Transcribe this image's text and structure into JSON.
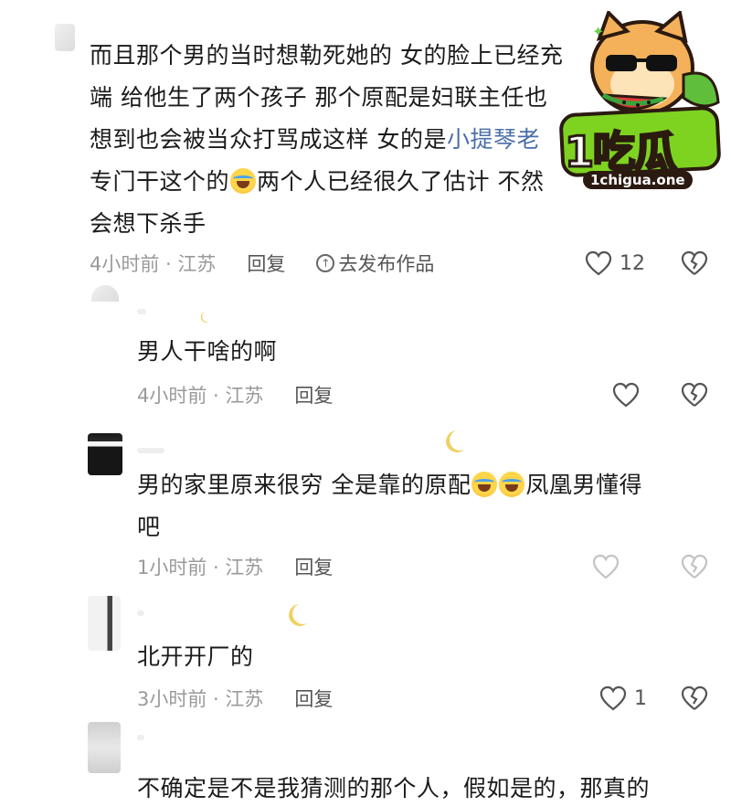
{
  "watermark": {
    "brand": "吃瓜",
    "number": "1",
    "url": "1chigua.one"
  },
  "comments": [
    {
      "id": "c1",
      "text_parts": [
        {
          "t": "而且那个男的当时想勒死她的 女的脸上已经充"
        },
        {
          "t": "端 给他生了两个孩子 那个原配是妇联主任也"
        },
        {
          "t": "想到也会被当众打骂成这样 女的是"
        },
        {
          "t": "小提琴老"
        },
        {
          "t": "专门干这个的"
        },
        {
          "t": "两个人已经很久了估计 不然"
        },
        {
          "t": "会想下杀手"
        }
      ],
      "time": "4小时前 · 江苏",
      "reply": "回复",
      "publish": "去发布作品",
      "likes": "12"
    },
    {
      "id": "c2",
      "text": "男人干啥的啊",
      "time": "4小时前 · 江苏",
      "reply": "回复",
      "likes": ""
    },
    {
      "id": "c3",
      "text_a": "男的家里原来很穷 全是靠的原配",
      "text_b": "凤凰男懂得",
      "text_c": "吧",
      "time": "1小时前 · 江苏",
      "reply": "回复",
      "likes": ""
    },
    {
      "id": "c4",
      "text": "北开开厂的",
      "time": "3小时前 · 江苏",
      "reply": "回复",
      "likes": "1"
    },
    {
      "id": "c5",
      "text": "不确定是不是我猜测的那个人，假如是的，那真的"
    }
  ],
  "colors": {
    "link": "#4a6ea9",
    "meta": "#9a9a9a",
    "text": "#1b1b1b"
  }
}
